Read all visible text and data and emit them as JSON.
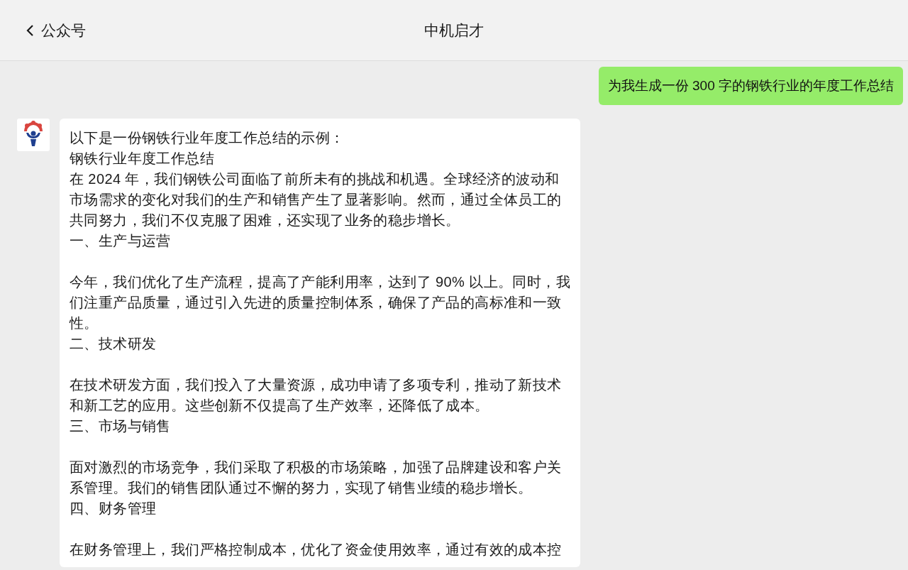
{
  "header": {
    "back_label": "公众号",
    "title": "中机启才"
  },
  "messages": [
    {
      "kind": "user",
      "text": "为我生成一份 300 字的钢铁行业的年度工作总结"
    },
    {
      "kind": "bot",
      "paragraphs": [
        {
          "kind": "text",
          "text": "以下是一份钢铁行业年度工作总结的示例："
        },
        {
          "kind": "text",
          "text": "钢铁行业年度工作总结"
        },
        {
          "kind": "text",
          "text": "在 2024 年，我们钢铁公司面临了前所未有的挑战和机遇。全球经济的波动和市场需求的变化对我们的生产和销售产生了显著影响。然而，通过全体员工的共同努力，我们不仅克服了困难，还实现了业务的稳步增长。"
        },
        {
          "kind": "section",
          "text": "一、生产与运营"
        },
        {
          "kind": "text",
          "text": "今年，我们优化了生产流程，提高了产能利用率，达到了 90% 以上。同时，我们注重产品质量，通过引入先进的质量控制体系，确保了产品的高标准和一致性。"
        },
        {
          "kind": "section",
          "text": "二、技术研发"
        },
        {
          "kind": "text",
          "text": "在技术研发方面，我们投入了大量资源，成功申请了多项专利，推动了新技术和新工艺的应用。这些创新不仅提高了生产效率，还降低了成本。"
        },
        {
          "kind": "section",
          "text": "三、市场与销售"
        },
        {
          "kind": "text",
          "text": "面对激烈的市场竞争，我们采取了积极的市场策略，加强了品牌建设和客户关系管理。我们的销售团队通过不懈的努力，实现了销售业绩的稳步增长。"
        },
        {
          "kind": "section",
          "text": "四、财务管理"
        },
        {
          "kind": "text",
          "text": "在财务管理上，我们严格控制成本，优化了资金使用效率，通过有效的成本控"
        }
      ]
    }
  ]
}
